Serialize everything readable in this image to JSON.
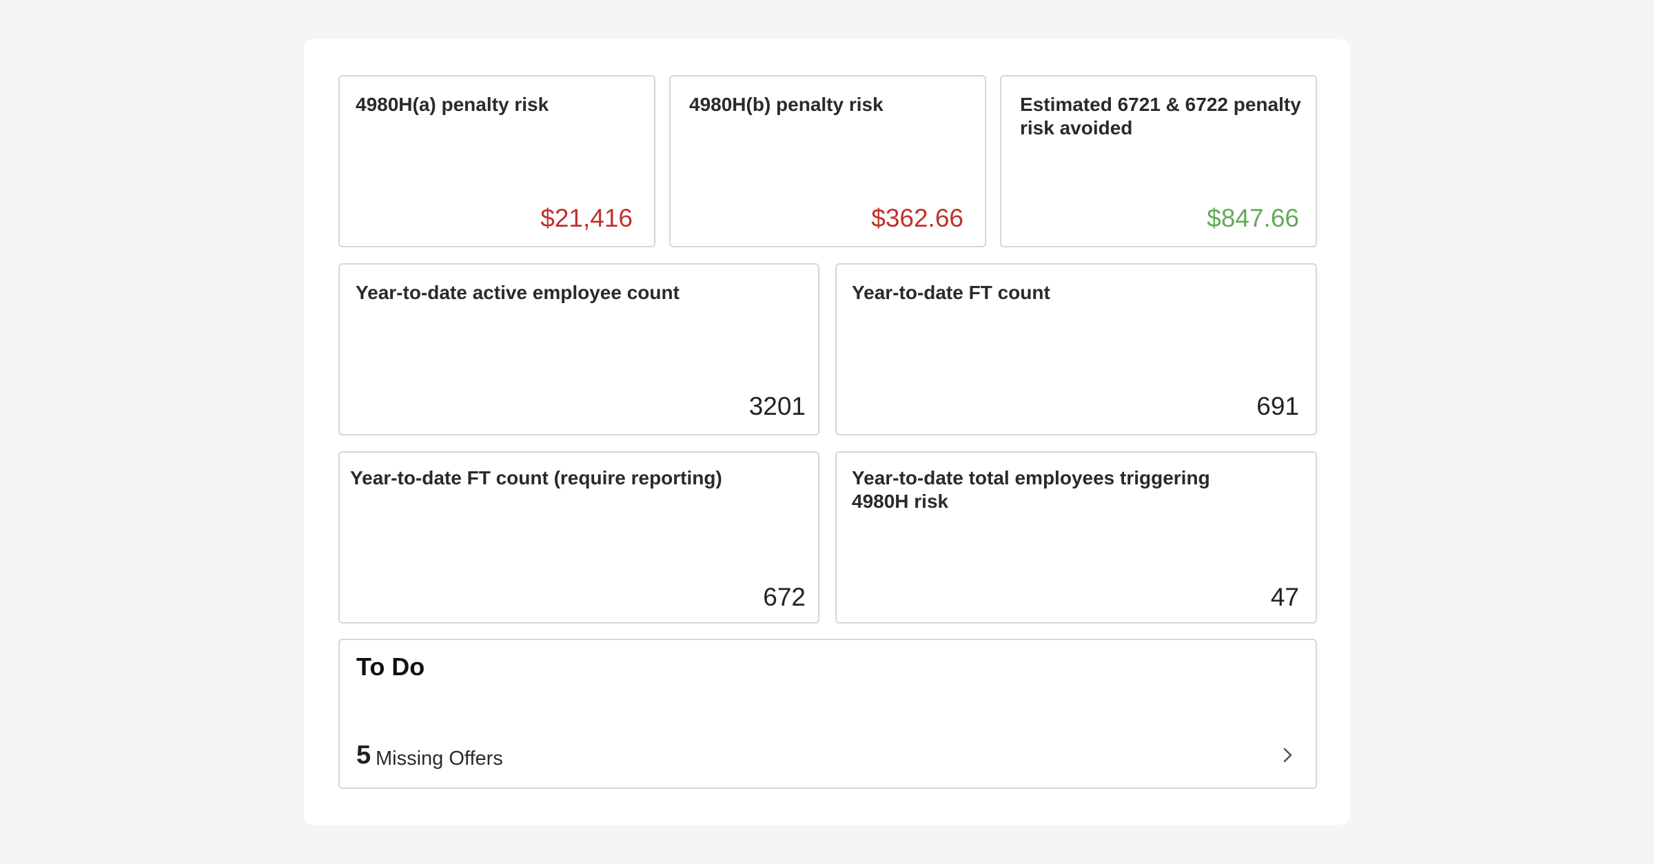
{
  "metrics_row1": [
    {
      "title": "4980H(a) penalty risk",
      "value": "$21,416"
    },
    {
      "title": "4980H(b) penalty risk",
      "value": "$362.66"
    },
    {
      "title": "Estimated 6721 & 6722 penalty risk avoided",
      "value": "$847.66"
    }
  ],
  "metrics_row2": [
    {
      "title": "Year-to-date active employee count",
      "value": "3201"
    },
    {
      "title": "Year-to-date FT count",
      "value": "691"
    }
  ],
  "metrics_row3": [
    {
      "title": "Year-to-date FT count (require reporting)",
      "value": "672"
    },
    {
      "title": "Year-to-date total employees triggering 4980H risk",
      "value": "47"
    }
  ],
  "todo": {
    "title": "To Do",
    "items": [
      {
        "count": "5",
        "label": "Missing Offers"
      }
    ]
  },
  "colors": {
    "negative": "#c0312b",
    "positive": "#62ab56"
  },
  "icons": {
    "todo_item_arrow": "chevron-right-icon"
  }
}
